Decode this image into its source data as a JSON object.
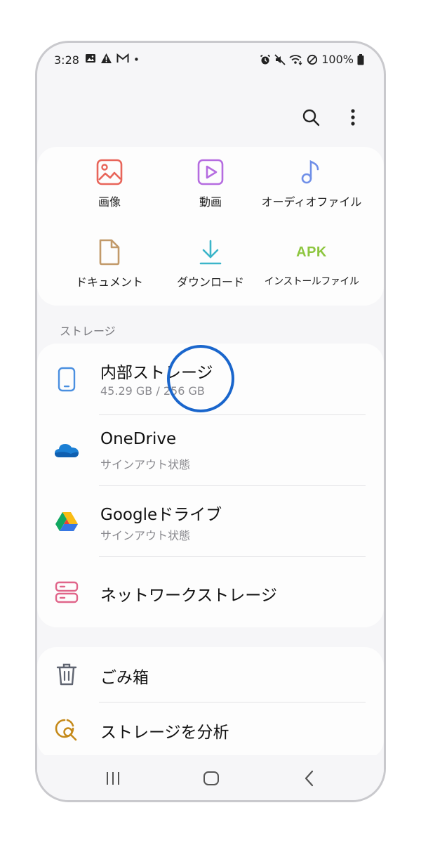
{
  "status_bar": {
    "time": "3:28",
    "dot": "•",
    "battery": "100%",
    "icons_left": [
      "image-icon",
      "warning-icon",
      "gmail-icon"
    ],
    "icons_right": [
      "alarm-icon",
      "mute-icon",
      "wifi-icon",
      "block-icon",
      "battery-icon"
    ]
  },
  "toolbar": {
    "search_icon": "search-icon",
    "more_icon": "more-vert-icon"
  },
  "categories": [
    {
      "label": "画像",
      "icon": "image-icon",
      "color": "#e8655a"
    },
    {
      "label": "動画",
      "icon": "video-icon",
      "color": "#b56ce0"
    },
    {
      "label": "オーディオファイル",
      "icon": "music-note-icon",
      "color": "#6f8fe8"
    },
    {
      "label": "ドキュメント",
      "icon": "document-icon",
      "color": "#c29a6a"
    },
    {
      "label": "ダウンロード",
      "icon": "download-icon",
      "color": "#3bb5c9"
    },
    {
      "label": "インストールファイル",
      "icon_text": "APK",
      "color": "#8dc63f"
    }
  ],
  "storage": {
    "section_label": "ストレージ",
    "items": [
      {
        "title": "内部ストレージ",
        "subtitle": "45.29 GB / 256 GB",
        "icon": "phone-icon",
        "color": "#4a8fe0"
      },
      {
        "title": "OneDrive",
        "subtitle": "サインアウト状態",
        "icon": "onedrive-icon",
        "color": "#1b7fd4"
      },
      {
        "title": "Googleドライブ",
        "subtitle": "サインアウト状態",
        "icon": "google-drive-icon"
      },
      {
        "title": "ネットワークストレージ",
        "icon": "network-storage-icon",
        "color": "#e0658a"
      }
    ]
  },
  "utilities": [
    {
      "title": "ごみ箱",
      "icon": "trash-icon",
      "color": "#5f6470"
    },
    {
      "title": "ストレージを分析",
      "icon": "analyze-storage-icon",
      "color": "#c58a1a"
    }
  ],
  "nav": {
    "recents_icon": "recents-icon",
    "home_icon": "home-icon",
    "back_icon": "back-icon"
  }
}
